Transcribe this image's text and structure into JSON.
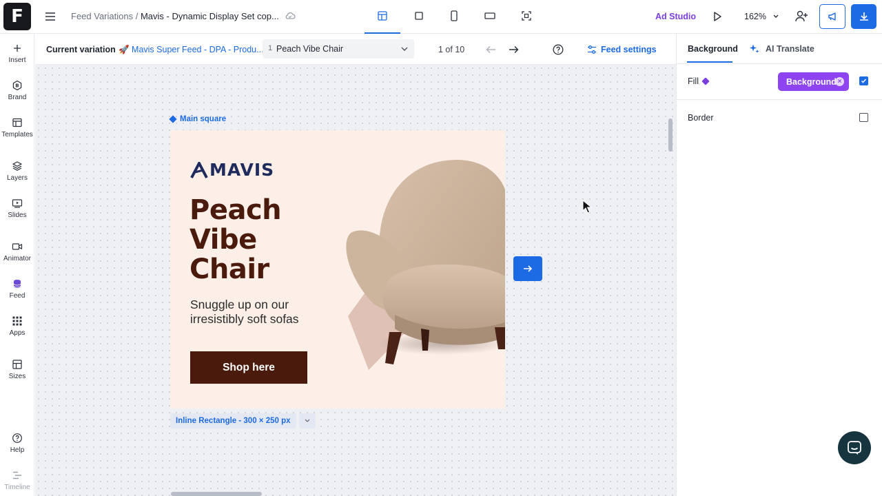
{
  "header": {
    "logo_letter": "F",
    "breadcrumb_parent": "Feed Variations",
    "breadcrumb_sep": "/",
    "breadcrumb_current": "Mavis - Dynamic Display Set cop...",
    "ad_studio_label": "Ad Studio",
    "zoom": "162%"
  },
  "sidebar": {
    "items": [
      {
        "label": "Insert"
      },
      {
        "label": "Brand"
      },
      {
        "label": "Templates"
      },
      {
        "label": "Layers"
      },
      {
        "label": "Slides"
      },
      {
        "label": "Animator"
      },
      {
        "label": "Feed"
      },
      {
        "label": "Apps"
      },
      {
        "label": "Sizes"
      },
      {
        "label": "Help"
      },
      {
        "label": "Timeline"
      }
    ]
  },
  "variation_bar": {
    "label": "Current variation",
    "feed_name": "🚀 Mavis Super Feed - DPA - Produ...",
    "selected_index": "1",
    "selected_item": "Peach Vibe Chair",
    "count": "1 of 10",
    "feed_settings": "Feed settings"
  },
  "canvas": {
    "frame_label": "Main square",
    "size_tag": "Inline Rectangle - 300 × 250 px",
    "ad": {
      "brand": "MAVIS",
      "headline_1": "Peach",
      "headline_2": "Vibe",
      "headline_3": "Chair",
      "subline": "Snuggle up on our irresistibly soft sofas",
      "cta": "Shop here"
    }
  },
  "right_panel": {
    "tab_background": "Background",
    "tab_ai": "AI Translate",
    "fill_label": "Fill",
    "fill_value": "Background",
    "fill_checked": true,
    "border_label": "Border",
    "border_checked": false
  },
  "colors": {
    "accent": "#1c6ae4",
    "purple": "#8e44f0",
    "ad_background": "#fcefe8",
    "ad_brown": "#4a1b0c"
  }
}
